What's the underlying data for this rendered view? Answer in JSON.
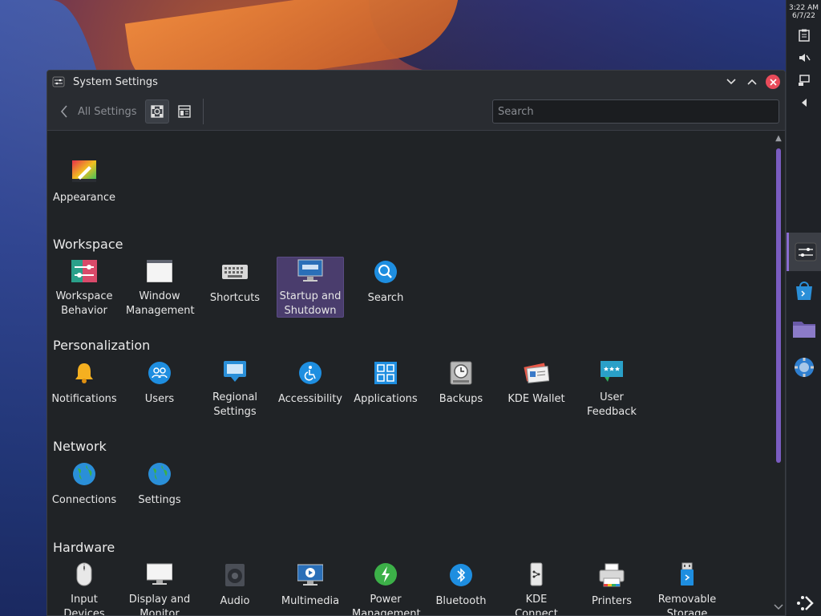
{
  "clock": {
    "time": "3:22 AM",
    "date": "6/7/22"
  },
  "window": {
    "title": "System Settings",
    "minimize_icon": "chevron-down",
    "maximize_icon": "chevron-up",
    "close_icon": "close"
  },
  "toolbar": {
    "back_label": "All Settings",
    "search_placeholder": "Search"
  },
  "sections": {
    "top": {
      "items": [
        {
          "label": "Appearance",
          "icon": "appearance-icon"
        }
      ]
    },
    "workspace": {
      "title": "Workspace",
      "items": [
        {
          "label": "Workspace Behavior",
          "icon": "workspace-behavior-icon"
        },
        {
          "label": "Window Management",
          "icon": "window-management-icon"
        },
        {
          "label": "Shortcuts",
          "icon": "keyboard-icon"
        },
        {
          "label": "Startup and Shutdown",
          "icon": "startup-icon",
          "selected": true
        },
        {
          "label": "Search",
          "icon": "search-icon"
        }
      ]
    },
    "personalization": {
      "title": "Personalization",
      "items": [
        {
          "label": "Notifications",
          "icon": "bell-icon"
        },
        {
          "label": "Users",
          "icon": "users-icon"
        },
        {
          "label": "Regional Settings",
          "icon": "regional-icon"
        },
        {
          "label": "Accessibility",
          "icon": "accessibility-icon"
        },
        {
          "label": "Applications",
          "icon": "applications-icon"
        },
        {
          "label": "Backups",
          "icon": "backups-icon"
        },
        {
          "label": "KDE Wallet",
          "icon": "wallet-icon"
        },
        {
          "label": "User Feedback",
          "icon": "feedback-icon"
        }
      ]
    },
    "network": {
      "title": "Network",
      "items": [
        {
          "label": "Connections",
          "icon": "globe-icon"
        },
        {
          "label": "Settings",
          "icon": "globe-icon"
        }
      ]
    },
    "hardware": {
      "title": "Hardware",
      "items": [
        {
          "label": "Input Devices",
          "icon": "mouse-icon"
        },
        {
          "label": "Display and Monitor",
          "icon": "monitor-icon"
        },
        {
          "label": "Audio",
          "icon": "speaker-icon"
        },
        {
          "label": "Multimedia",
          "icon": "multimedia-icon"
        },
        {
          "label": "Power Management",
          "icon": "power-icon"
        },
        {
          "label": "Bluetooth",
          "icon": "bluetooth-icon"
        },
        {
          "label": "KDE Connect",
          "icon": "phone-icon"
        },
        {
          "label": "Printers",
          "icon": "printer-icon"
        },
        {
          "label": "Removable Storage",
          "icon": "usb-icon"
        }
      ]
    }
  },
  "colors": {
    "accent": "#7a5cc0",
    "selection": "#4a3d6d",
    "close": "#e94b5a"
  }
}
